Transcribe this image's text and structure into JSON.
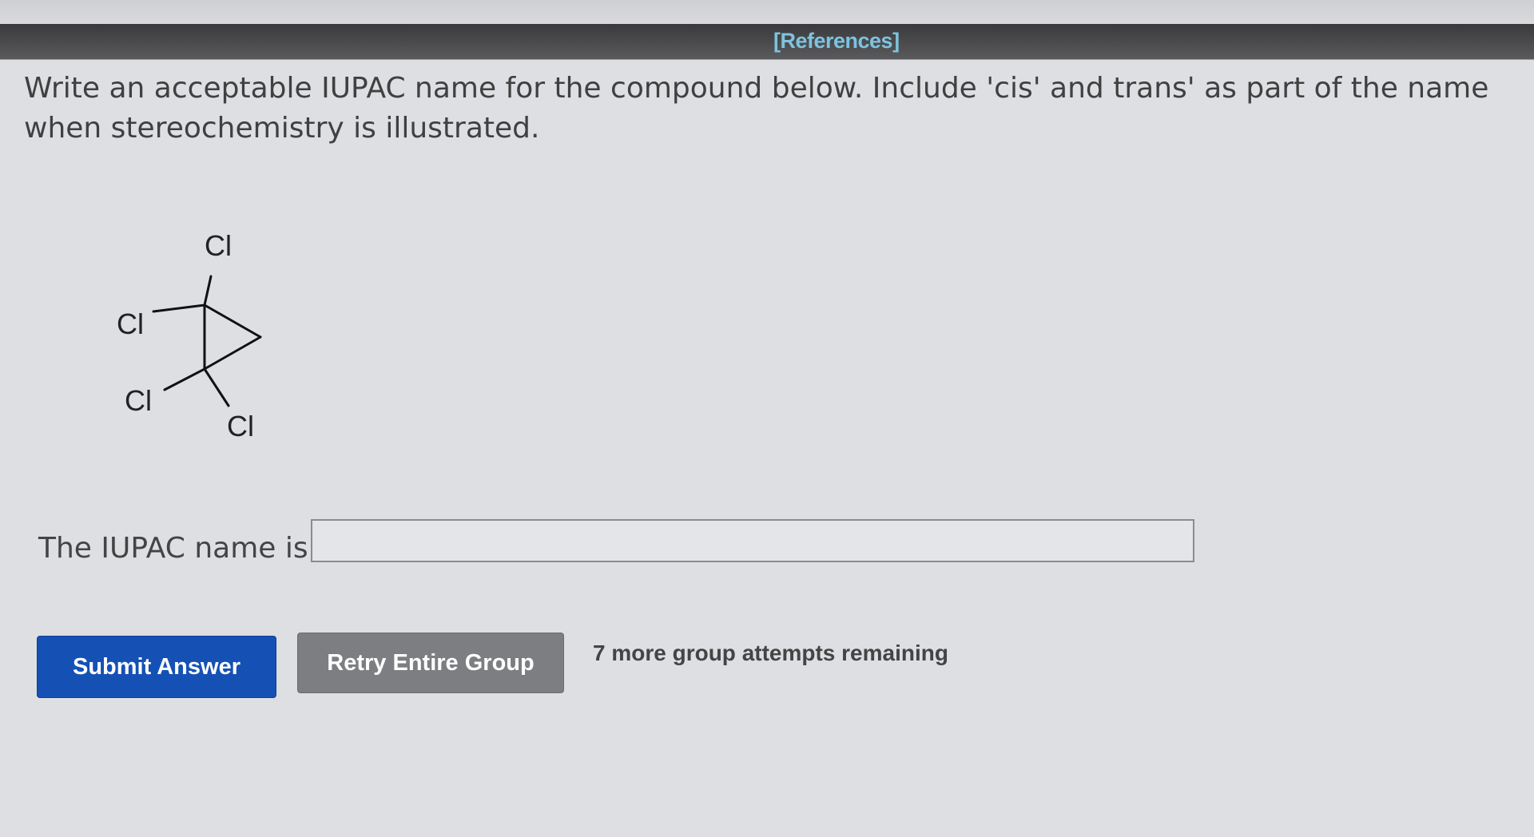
{
  "header": {
    "references_link": "[References]"
  },
  "question": {
    "prompt": "Write an acceptable IUPAC name for the compound below. Include 'cis' and trans' as part of the name when stereochemistry is illustrated."
  },
  "molecule": {
    "atom_label": "Cl",
    "substituents": [
      "Cl",
      "Cl",
      "Cl",
      "Cl"
    ]
  },
  "answer": {
    "label": "The IUPAC name is",
    "value": "",
    "placeholder": ""
  },
  "actions": {
    "submit_label": "Submit Answer",
    "retry_label": "Retry Entire Group",
    "attempts_text": "7 more group attempts remaining"
  },
  "colors": {
    "submit_bg": "#1551b5",
    "retry_bg": "#7d7e81",
    "references_link": "#7ec3df"
  }
}
